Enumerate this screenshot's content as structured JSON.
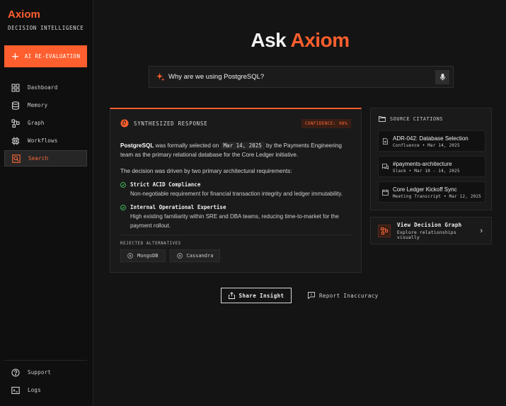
{
  "brand": {
    "name": "Axiom",
    "tagline": "DECISION INTELLIGENCE"
  },
  "sidebar": {
    "reeval_label": "AI RE-EVALUATION",
    "items": [
      {
        "label": "Dashboard",
        "icon": "dashboard-icon"
      },
      {
        "label": "Memory",
        "icon": "database-icon"
      },
      {
        "label": "Graph",
        "icon": "graph-icon"
      },
      {
        "label": "Workflows",
        "icon": "workflow-icon"
      },
      {
        "label": "Search",
        "icon": "search-icon",
        "active": true
      }
    ],
    "bottom_items": [
      {
        "label": "Support",
        "icon": "help-icon"
      },
      {
        "label": "Logs",
        "icon": "terminal-icon"
      }
    ]
  },
  "hero": {
    "prefix": "Ask",
    "accent": "Axiom"
  },
  "search": {
    "value": "Why are we using PostgreSQL?"
  },
  "response": {
    "title": "SYNTHESIZED RESPONSE",
    "confidence": "CONFIDENCE: 98%",
    "p1_subject": "PostgreSQL",
    "p1_mid": "was formally selected on",
    "p1_date": "Mar 14, 2025",
    "p1_end": "by the Payments Engineering team as the primary relational database for the Core Ledger initiative.",
    "p2": "The decision was driven by two primary architectural requirements:",
    "requirements": [
      {
        "title": "Strict ACID Compliance",
        "desc": "Non-negotiable requirement for financial transaction integrity and ledger immutability."
      },
      {
        "title": "Internal Operational Expertise",
        "desc": "High existing familiarity within SRE and DBA teams, reducing time-to-market for the payment rollout."
      }
    ],
    "rejected_label": "REJECTED ALTERNATIVES",
    "rejected": [
      "MongoDB",
      "Cassandra"
    ]
  },
  "citations": {
    "title": "SOURCE CITATIONS",
    "items": [
      {
        "title": "ADR-042: Database Selection",
        "meta": "Confluence • Mar 14, 2025",
        "icon": "document-icon"
      },
      {
        "title": "#payments-architecture",
        "meta": "Slack • Mar 10 - 14, 2025",
        "icon": "chat-icon"
      },
      {
        "title": "Core Ledger Kickoff Sync",
        "meta": "Meeting Transcript • Mar 12, 2025",
        "icon": "calendar-icon"
      }
    ]
  },
  "graph_link": {
    "title": "View Decision Graph",
    "subtitle": "Explore relationships visually"
  },
  "actions": {
    "share": "Share Insight",
    "report": "Report Inaccuracy"
  },
  "colors": {
    "accent": "#ff5f2e",
    "background": "#141414",
    "sidebar": "#0f0f0f",
    "success": "#3fbf5f"
  }
}
